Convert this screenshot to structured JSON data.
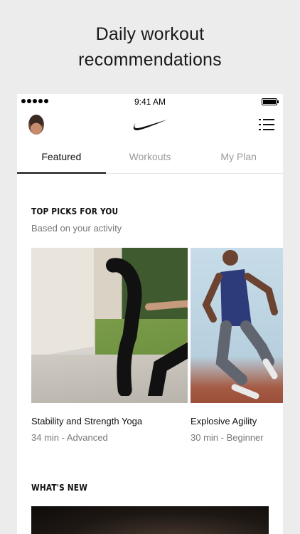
{
  "caption": {
    "line1": "Daily workout",
    "line2": "recommendations"
  },
  "status_bar": {
    "time": "9:41 AM"
  },
  "nav": {
    "avatar_icon": "user-avatar",
    "logo_icon": "nike-swoosh",
    "menu_icon": "list-menu-icon"
  },
  "tabs": [
    {
      "label": "Featured",
      "active": true
    },
    {
      "label": "Workouts",
      "active": false
    },
    {
      "label": "My Plan",
      "active": false
    }
  ],
  "top_picks": {
    "title": "TOP PICKS FOR YOU",
    "subtitle": "Based on your activity",
    "cards": [
      {
        "name": "Stability and Strength Yoga",
        "meta": "34 min - Advanced"
      },
      {
        "name": "Explosive Agility",
        "meta": "30 min - Beginner"
      }
    ]
  },
  "whats_new": {
    "title": "WHAT'S NEW"
  }
}
